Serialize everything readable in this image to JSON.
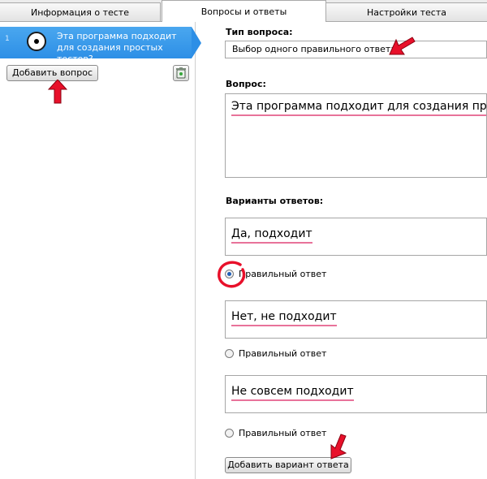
{
  "tabs": [
    {
      "label": "Информация о тесте"
    },
    {
      "label": "Вопросы и ответы"
    },
    {
      "label": "Настройки теста"
    }
  ],
  "sidebar": {
    "question": {
      "number": "1",
      "text": "Эта программа подходит для создания простых тестов?"
    },
    "add_button": "Добавить вопрос",
    "delete_icon": "trash-icon"
  },
  "editor": {
    "type_label": "Тип вопроса:",
    "type_value": "Выбор одного правильного ответа",
    "question_label": "Вопрос:",
    "question_text": "Эта программа подходит для создания простых тестов?",
    "answers_label": "Варианты ответов:",
    "answers": [
      {
        "text": "Да, подходит",
        "correct_label": "Правильный ответ",
        "checked": true
      },
      {
        "text": "Нет, не подходит",
        "correct_label": "Правильный ответ",
        "checked": false
      },
      {
        "text": "Не совсем подходит",
        "correct_label": "Правильный ответ",
        "checked": false
      }
    ],
    "add_answer_button": "Добавить вариант ответа"
  },
  "colors": {
    "selection": "#2d8fe6",
    "annotation_red": "#e8102a",
    "spell_underline": "#e8739a"
  }
}
